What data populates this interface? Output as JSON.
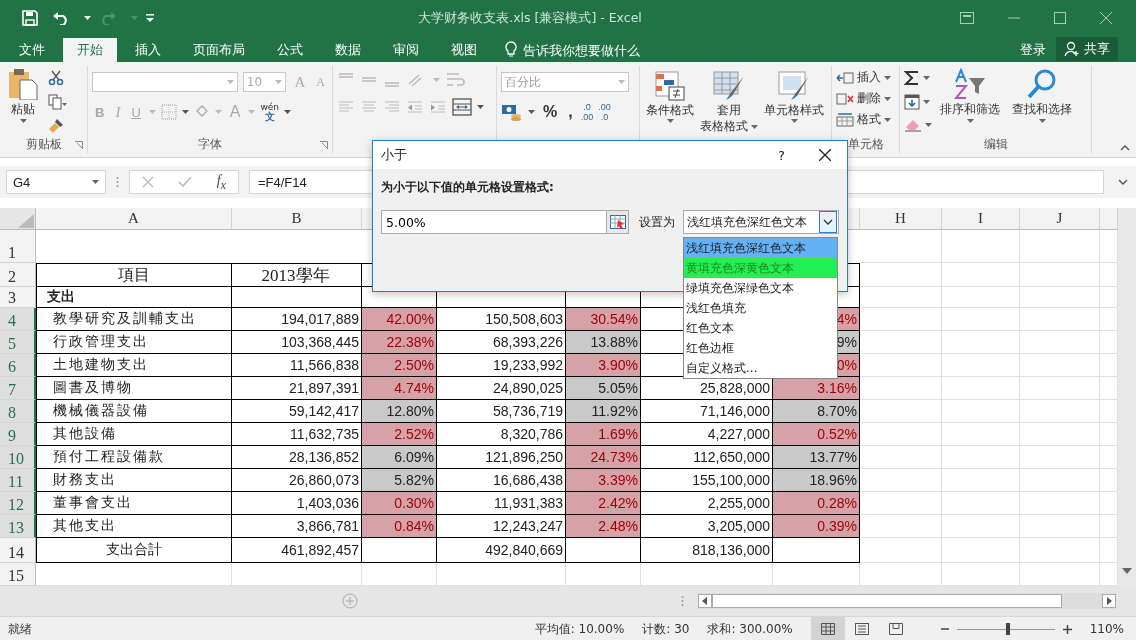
{
  "title_bar": {
    "title": "大学财务收支表.xls  [兼容模式] - Excel"
  },
  "menu_tabs": [
    {
      "label": "文件",
      "selected": false
    },
    {
      "label": "开始",
      "selected": true
    },
    {
      "label": "插入",
      "selected": false
    },
    {
      "label": "页面布局",
      "selected": false
    },
    {
      "label": "公式",
      "selected": false
    },
    {
      "label": "数据",
      "selected": false
    },
    {
      "label": "审阅",
      "selected": false
    },
    {
      "label": "视图",
      "selected": false
    }
  ],
  "tell_me": "告诉我你想要做什么",
  "sign_in": "登录",
  "share": "共享",
  "ribbon": {
    "clipboard": {
      "paste": "粘贴",
      "label": "剪贴板"
    },
    "font": {
      "size": "10",
      "grow": "A",
      "shrink": "A",
      "bold": "B",
      "italic": "I",
      "underline": "U",
      "font_color": "A",
      "phonetic_top": "wén",
      "phonetic_bottom": "文",
      "label": "字体"
    },
    "number": {
      "format": "百分比",
      "percent": "%",
      "comma": ",",
      "add_decimal": [
        ".0",
        ".00"
      ],
      "remove_decimal": [
        ".00",
        ".0"
      ]
    },
    "styles": [
      {
        "lines": [
          "条件格式"
        ],
        "kind": "conditional"
      },
      {
        "lines": [
          "套用",
          "表格格式"
        ],
        "kind": "table"
      },
      {
        "lines": [
          "单元格样式"
        ],
        "kind": "cell"
      }
    ],
    "cells": {
      "items": [
        {
          "label": "插入",
          "kind": "insert"
        },
        {
          "label": "删除",
          "kind": "delete"
        },
        {
          "label": "格式",
          "kind": "format"
        }
      ],
      "label": "单元格"
    },
    "editing": {
      "sort": "排序和筛选",
      "find": "查找和选择",
      "label": "编辑"
    }
  },
  "formula_bar": {
    "name_box": "G4",
    "fx": "f$_{x}$",
    "formula": "=F4/F14"
  },
  "sheet": {
    "column_headers": [
      "A",
      "B",
      "H",
      "I",
      "J"
    ],
    "rows": [
      {
        "number": "1",
        "kind": "spacer",
        "selected": false
      },
      {
        "number": "2",
        "kind": "header",
        "selected": false,
        "a": "項目",
        "b": "2013學年"
      },
      {
        "number": "3",
        "kind": "section",
        "selected": false,
        "a": "支出"
      },
      {
        "number": "4",
        "kind": "item",
        "selected": true,
        "a": "教學研究及訓輔支出",
        "b": "194,017,889",
        "c": {
          "text": "42.00%",
          "highlighted": true
        },
        "d": "150,508,603",
        "e": {
          "text": "30.54%",
          "highlighted": true
        },
        "g": {
          "text": "4%",
          "highlighted": true
        }
      },
      {
        "number": "5",
        "kind": "item",
        "selected": true,
        "a": "行政管理支出",
        "b": "103,368,445",
        "c": {
          "text": "22.38%",
          "highlighted": true
        },
        "d": "68,393,226",
        "e": {
          "text": "13.88%",
          "highlighted": false
        },
        "g": {
          "text": "9%",
          "highlighted": false
        }
      },
      {
        "number": "6",
        "kind": "item",
        "selected": true,
        "a": "土地建物支出",
        "b": "11,566,838",
        "c": {
          "text": "2.50%",
          "highlighted": true
        },
        "d": "19,233,992",
        "e": {
          "text": "3.90%",
          "highlighted": true
        },
        "g": {
          "text": "0%",
          "highlighted": true
        }
      },
      {
        "number": "7",
        "kind": "item",
        "selected": true,
        "a": "圖書及博物",
        "b": "21,897,391",
        "c": {
          "text": "4.74%",
          "highlighted": true
        },
        "d": "24,890,025",
        "e": {
          "text": "5.05%",
          "highlighted": false
        },
        "f": "25,828,000",
        "g": {
          "text": "3.16%",
          "highlighted": true
        }
      },
      {
        "number": "8",
        "kind": "item",
        "selected": true,
        "a": "機械儀器設備",
        "b": "59,142,417",
        "c": {
          "text": "12.80%",
          "highlighted": false
        },
        "d": "58,736,719",
        "e": {
          "text": "11.92%",
          "highlighted": false
        },
        "f": "71,146,000",
        "g": {
          "text": "8.70%",
          "highlighted": false
        }
      },
      {
        "number": "9",
        "kind": "item",
        "selected": true,
        "a": "其他設備",
        "b": "11,632,735",
        "c": {
          "text": "2.52%",
          "highlighted": true
        },
        "d": "8,320,786",
        "e": {
          "text": "1.69%",
          "highlighted": true
        },
        "f": "4,227,000",
        "g": {
          "text": "0.52%",
          "highlighted": true
        }
      },
      {
        "number": "10",
        "kind": "item",
        "selected": true,
        "a": "預付工程設備款",
        "b": "28,136,852",
        "c": {
          "text": "6.09%",
          "highlighted": false
        },
        "d": "121,896,250",
        "e": {
          "text": "24.73%",
          "highlighted": true
        },
        "f": "112,650,000",
        "g": {
          "text": "13.77%",
          "highlighted": false
        }
      },
      {
        "number": "11",
        "kind": "item",
        "selected": true,
        "a": "財務支出",
        "b": "26,860,073",
        "c": {
          "text": "5.82%",
          "highlighted": false
        },
        "d": "16,686,438",
        "e": {
          "text": "3.39%",
          "highlighted": true
        },
        "f": "155,100,000",
        "g": {
          "text": "18.96%",
          "highlighted": false
        }
      },
      {
        "number": "12",
        "kind": "item",
        "selected": true,
        "a": "董事會支出",
        "b": "1,403,036",
        "c": {
          "text": "0.30%",
          "highlighted": true
        },
        "d": "11,931,383",
        "e": {
          "text": "2.42%",
          "highlighted": true
        },
        "f": "2,255,000",
        "g": {
          "text": "0.28%",
          "highlighted": true
        }
      },
      {
        "number": "13",
        "kind": "item",
        "selected": true,
        "a": "其他支出",
        "b": "3,866,781",
        "c": {
          "text": "0.84%",
          "highlighted": true
        },
        "d": "12,243,247",
        "e": {
          "text": "2.48%",
          "highlighted": true
        },
        "f": "3,205,000",
        "g": {
          "text": "0.39%",
          "highlighted": true
        }
      },
      {
        "number": "14",
        "kind": "total",
        "selected": false,
        "a": "支出合計",
        "b": "461,892,457",
        "d": "492,840,669",
        "f": "818,136,000"
      },
      {
        "number": "15",
        "selected": false
      }
    ]
  },
  "dialog": {
    "title": "小于",
    "help": "?",
    "prompt": "为小于以下值的单元格设置格式:",
    "value": "5.00%",
    "set_as_label": "设置为",
    "format": "浅红填充色深红色文本",
    "options": [
      {
        "label": "浅红填充色深红色文本",
        "selected": true,
        "hovered": false
      },
      {
        "label": "黄填充色深黄色文本",
        "selected": false,
        "hovered": true
      },
      {
        "label": "绿填充色深绿色文本",
        "selected": false,
        "hovered": false
      },
      {
        "label": "浅红色填充",
        "selected": false,
        "hovered": false
      },
      {
        "label": "红色文本",
        "selected": false,
        "hovered": false
      },
      {
        "label": "红色边框",
        "selected": false,
        "hovered": false
      },
      {
        "label": "自定义格式...",
        "selected": false,
        "hovered": false
      }
    ]
  },
  "status_bar": {
    "ready": "就绪",
    "stats": [
      "平均值: 10.00%",
      "计数: 30",
      "求和: 300.00%"
    ],
    "views": [
      {
        "kind": "normal",
        "selected": true
      },
      {
        "kind": "page_layout",
        "selected": false
      },
      {
        "kind": "page_break",
        "selected": false
      }
    ],
    "zoom": {
      "level": 0.52,
      "label": "110%"
    }
  }
}
